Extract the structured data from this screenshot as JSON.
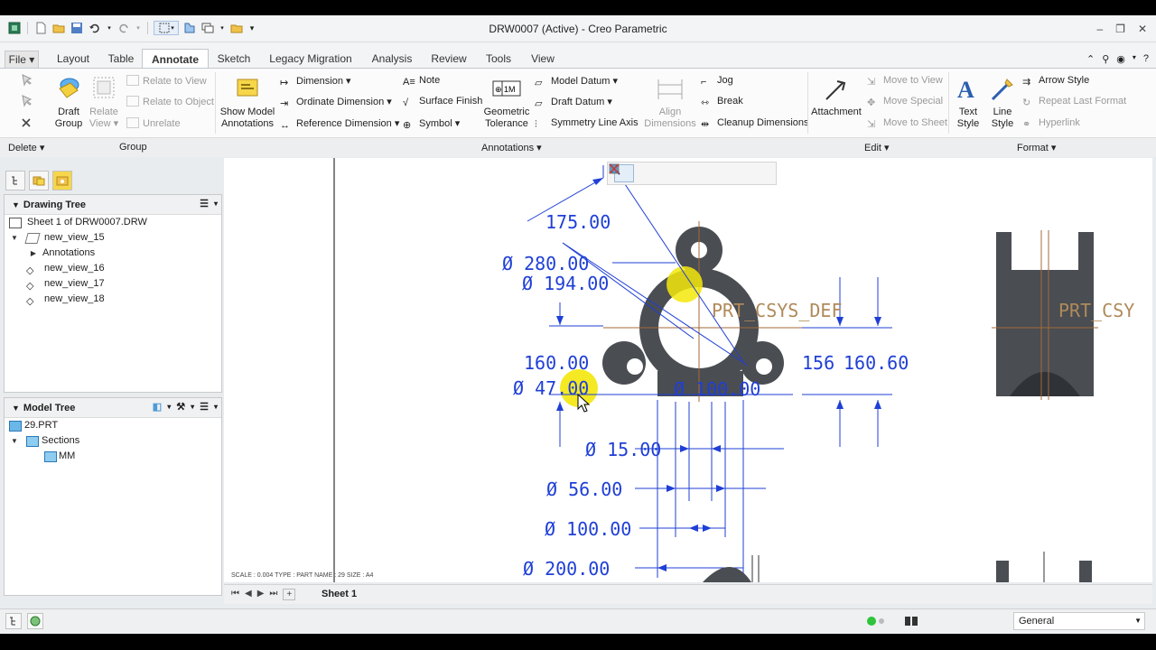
{
  "window": {
    "title": "DRW0007 (Active) - Creo Parametric",
    "controls": [
      "–",
      "❐",
      "✕"
    ]
  },
  "tabs": [
    "File ▾",
    "Layout",
    "Table",
    "Annotate",
    "Sketch",
    "Legacy Migration",
    "Analysis",
    "Review",
    "Tools",
    "View"
  ],
  "active_tab": "Annotate",
  "ribbon": {
    "group_delete": "Delete ▾",
    "group_group": "Group",
    "group_annotations": "Annotations ▾",
    "group_edit": "Edit ▾",
    "group_format": "Format ▾",
    "draft_group": "Draft\nGroup",
    "relate_view": "Relate\nView ▾",
    "relate_to_view": "Relate to View",
    "relate_to_object": "Relate to Object",
    "unrelate": "Unrelate",
    "show_model_annotations": "Show Model\nAnnotations",
    "dimension": "Dimension",
    "ordinate_dimension": "Ordinate Dimension",
    "reference_dimension": "Reference Dimension",
    "note": "Note",
    "surface_finish": "Surface Finish",
    "symbol": "Symbol",
    "geometric_tolerance": "Geometric\nTolerance",
    "model_datum": "Model Datum",
    "draft_datum": "Draft Datum",
    "symmetry_line_axis": "Symmetry Line Axis",
    "align_dimensions": "Align\nDimensions",
    "jog": "Jog",
    "break": "Break",
    "cleanup_dimensions": "Cleanup Dimensions",
    "attachment": "Attachment",
    "move_to_view": "Move to View",
    "move_special": "Move Special",
    "move_to_sheet": "Move to Sheet",
    "text_style": "Text\nStyle",
    "line_style": "Line\nStyle",
    "arrow_style": "Arrow Style",
    "repeat_last_format": "Repeat Last Format",
    "hyperlink": "Hyperlink"
  },
  "drawing_tree": {
    "title": "Drawing Tree",
    "items": [
      "Sheet 1 of DRW0007.DRW",
      "new_view_15",
      "Annotations",
      "new_view_16",
      "new_view_17",
      "new_view_18"
    ]
  },
  "model_tree": {
    "title": "Model Tree",
    "items": [
      "29.PRT",
      "Sections",
      "MM"
    ]
  },
  "drawing": {
    "dims": [
      "175.00",
      "Ø 280.00",
      "Ø 194.00",
      "160.00",
      "Ø 47.00",
      "Ø 100.00",
      "156",
      "160.60",
      "Ø 15.00",
      "Ø 56.00",
      "Ø 100.00",
      "Ø 200.00"
    ],
    "csys_1": "PRT_CSYS_DEF",
    "csys_2": "PRT_CSY",
    "sheet_info": "SCALE : 0.004     TYPE : PART     NAME : 29     SIZE : A4"
  },
  "sheet_tab": "Sheet 1",
  "status": {
    "filter": "General"
  },
  "colors": {
    "dimension": "#1f3fd6",
    "part": "#4a4d52",
    "highlight": "#f3e70b",
    "csys": "#b08a5a"
  }
}
